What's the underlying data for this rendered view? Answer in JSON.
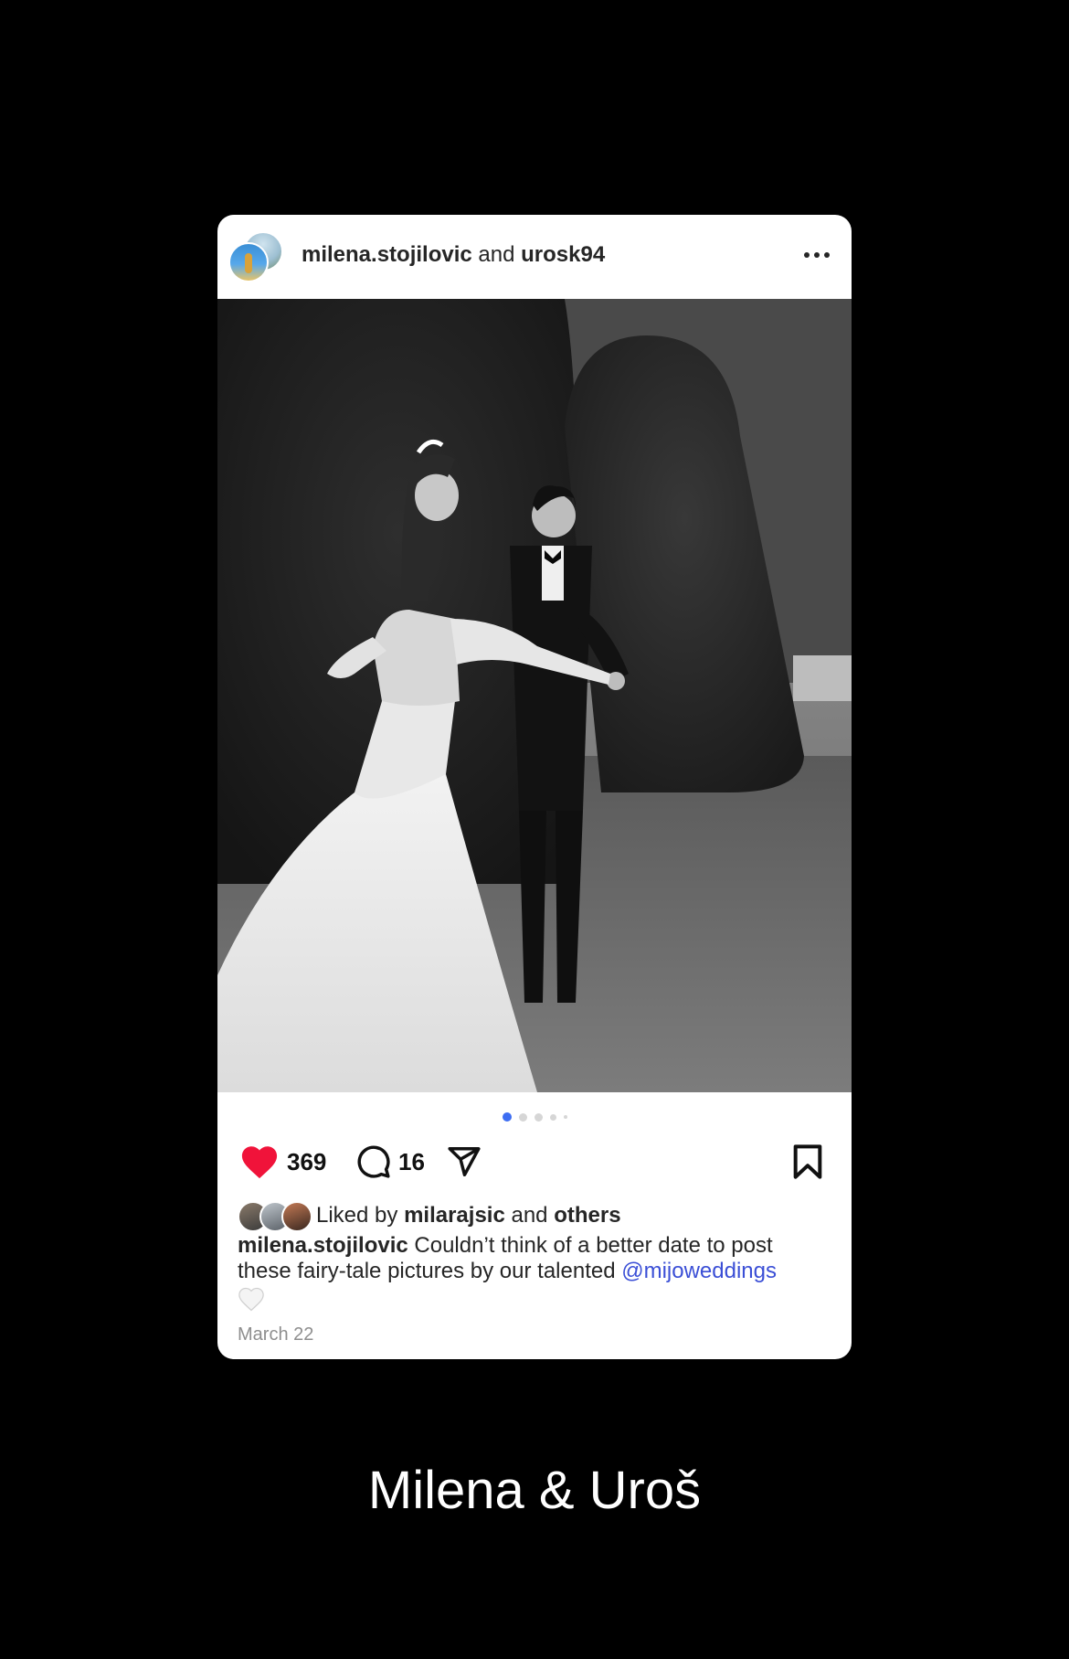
{
  "post": {
    "author1": "milena.stojilovic",
    "joiner": "and",
    "author2": "urosk94",
    "likes_count": "369",
    "comments_count": "16",
    "carousel_active_index": 1,
    "carousel_total": 5,
    "liked_prefix": "Liked by",
    "liked_user": "milarajsic",
    "liked_and": "and",
    "liked_suffix": "others",
    "caption_user": "milena.stojilovic",
    "caption_text": "Couldn’t think of a better date to post these fairy-tale pictures by our talented",
    "caption_mention": "@mijoweddings",
    "date": "March 22"
  },
  "icons": {
    "more": "more-horizontal-icon",
    "like": "heart-filled-icon",
    "comment": "comment-bubble-icon",
    "share": "send-icon",
    "save": "bookmark-icon",
    "caption_emoji": "white-heart-icon"
  },
  "colors": {
    "like": "#f0133a",
    "mention": "#3b4fd6",
    "active_dot": "#3d6df2"
  },
  "footer": {
    "title": "Milena & Uroš"
  }
}
